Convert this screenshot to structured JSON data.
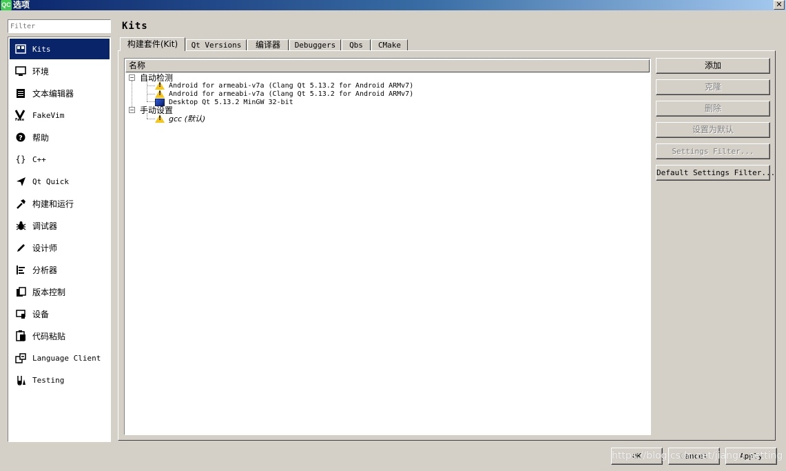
{
  "window": {
    "app_icon": "QC",
    "title": "选项",
    "close_glyph": "✕"
  },
  "filter": {
    "placeholder": "Filter",
    "value": ""
  },
  "sidebar": {
    "items": [
      {
        "label": "Kits",
        "icon": "kits-icon",
        "selected": true
      },
      {
        "label": "环境",
        "icon": "monitor-icon"
      },
      {
        "label": "文本编辑器",
        "icon": "text-editor-icon"
      },
      {
        "label": "FakeVim",
        "icon": "fakevim-icon"
      },
      {
        "label": "帮助",
        "icon": "help-icon"
      },
      {
        "label": "C++",
        "icon": "braces-icon"
      },
      {
        "label": "Qt Quick",
        "icon": "paper-plane-icon"
      },
      {
        "label": "构建和运行",
        "icon": "hammer-icon"
      },
      {
        "label": "调试器",
        "icon": "bug-icon"
      },
      {
        "label": "设计师",
        "icon": "pencil-icon"
      },
      {
        "label": "分析器",
        "icon": "analyzer-icon"
      },
      {
        "label": "版本控制",
        "icon": "version-control-icon"
      },
      {
        "label": "设备",
        "icon": "device-icon"
      },
      {
        "label": "代码粘贴",
        "icon": "clipboard-icon"
      },
      {
        "label": "Language Client",
        "icon": "language-client-icon"
      },
      {
        "label": "Testing",
        "icon": "flask-icon"
      }
    ]
  },
  "page": {
    "title": "Kits"
  },
  "tabs": [
    {
      "label": "构建套件(Kit)",
      "active": true
    },
    {
      "label": "Qt Versions"
    },
    {
      "label": "编译器"
    },
    {
      "label": "Debuggers"
    },
    {
      "label": "Qbs"
    },
    {
      "label": "CMake"
    }
  ],
  "tree": {
    "header": "名称",
    "groups": [
      {
        "label": "自动检测",
        "expander": "−",
        "children": [
          {
            "label": "Android for armeabi-v7a (Clang Qt 5.13.2 for Android ARMv7)",
            "icon": "warning-icon"
          },
          {
            "label": "Android for armeabi-v7a (Clang Qt 5.13.2 for Android ARMv7)",
            "icon": "warning-icon"
          },
          {
            "label": "Desktop Qt 5.13.2 MinGW 32-bit",
            "icon": "desktop-icon"
          }
        ]
      },
      {
        "label": "手动设置",
        "expander": "−",
        "children": [
          {
            "label": "gcc (默认)",
            "icon": "warning-icon",
            "italic": true
          }
        ]
      }
    ]
  },
  "side_buttons": [
    {
      "label": "添加",
      "enabled": true
    },
    {
      "label": "克隆",
      "enabled": false
    },
    {
      "label": "删除",
      "enabled": false
    },
    {
      "label": "设置为默认",
      "enabled": false
    },
    {
      "label": "Settings Filter...",
      "enabled": false
    },
    {
      "label": "Default Settings Filter...",
      "enabled": true
    }
  ],
  "footer": {
    "ok": "OK",
    "cancel": "Cancel",
    "apply": "Apply"
  },
  "watermark": "https://blog.csdn.net/jiangu_setting"
}
